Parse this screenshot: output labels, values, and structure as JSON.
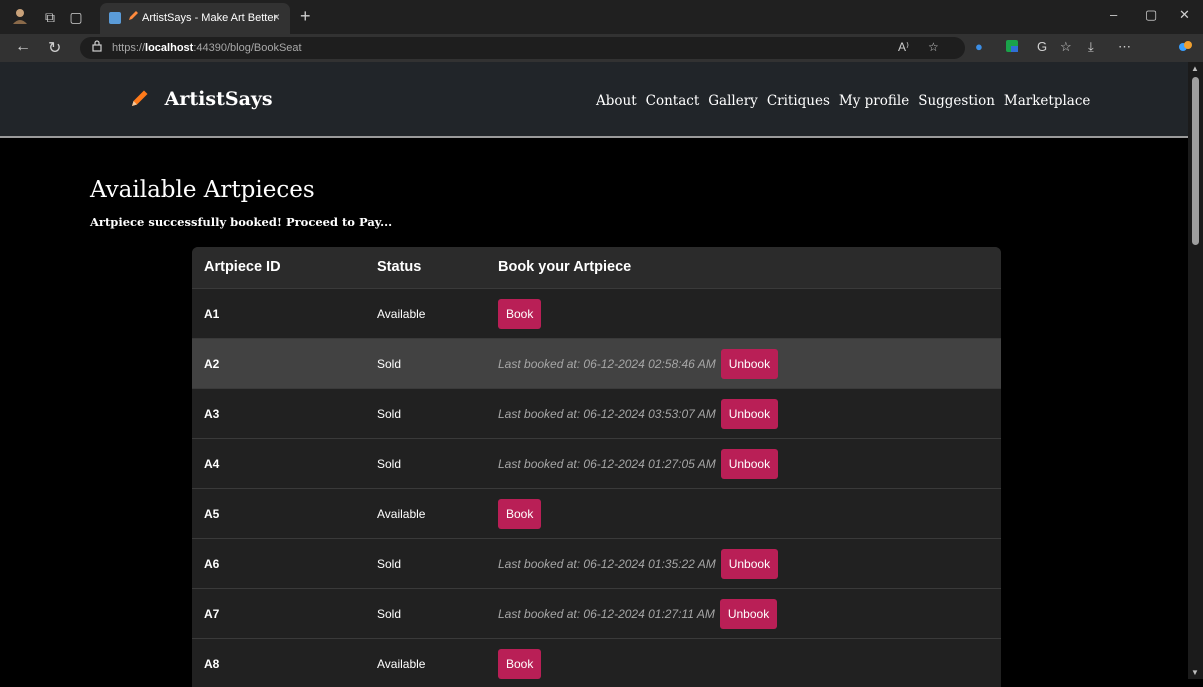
{
  "browser": {
    "tab_title": "ArtistSays - Make Art Better",
    "tab_close": "×",
    "new_tab": "+",
    "url_prefix": "https://",
    "url_host": "localhost",
    "url_rest": ":44390/blog/BookSeat",
    "icons": {
      "profile": "profile-avatar-icon",
      "back": "back-arrow-icon",
      "refresh": "refresh-icon",
      "lock": "lock-icon",
      "read_aloud": "read-aloud-icon",
      "favorite": "favorite-star-icon"
    },
    "read_aloud_text": "A⁾",
    "window_controls": {
      "minimize": "–",
      "restore": "▢",
      "close": "✕"
    }
  },
  "site": {
    "brand": "ArtistSays",
    "brand_icon": "pencil-icon",
    "nav": [
      "About",
      "Contact",
      "Gallery",
      "Critiques",
      "My profile",
      "Suggestion",
      "Marketplace"
    ]
  },
  "main": {
    "title": "Available Artpieces",
    "message": "Artpiece successfully booked! Proceed to Pay..."
  },
  "table": {
    "headers": [
      "Artpiece ID",
      "Status",
      "Book your Artpiece"
    ],
    "rows": [
      {
        "id": "A1",
        "status": "Available",
        "booked_text": "",
        "button": "Book"
      },
      {
        "id": "A2",
        "status": "Sold",
        "booked_text": "Last booked at: 06-12-2024 02:58:46 AM",
        "button": "Unbook"
      },
      {
        "id": "A3",
        "status": "Sold",
        "booked_text": "Last booked at: 06-12-2024 03:53:07 AM",
        "button": "Unbook"
      },
      {
        "id": "A4",
        "status": "Sold",
        "booked_text": "Last booked at: 06-12-2024 01:27:05 AM",
        "button": "Unbook"
      },
      {
        "id": "A5",
        "status": "Available",
        "booked_text": "",
        "button": "Book"
      },
      {
        "id": "A6",
        "status": "Sold",
        "booked_text": "Last booked at: 06-12-2024 01:35:22 AM",
        "button": "Unbook"
      },
      {
        "id": "A7",
        "status": "Sold",
        "booked_text": "Last booked at: 06-12-2024 01:27:11 AM",
        "button": "Unbook"
      },
      {
        "id": "A8",
        "status": "Available",
        "booked_text": "",
        "button": "Book"
      }
    ],
    "hover_row": "A2"
  },
  "colors": {
    "button": "#b91f56",
    "header_bg": "#212529",
    "table_bg": "#212121",
    "hover_row_bg": "#424242",
    "pencil": "#ff7a1a"
  }
}
